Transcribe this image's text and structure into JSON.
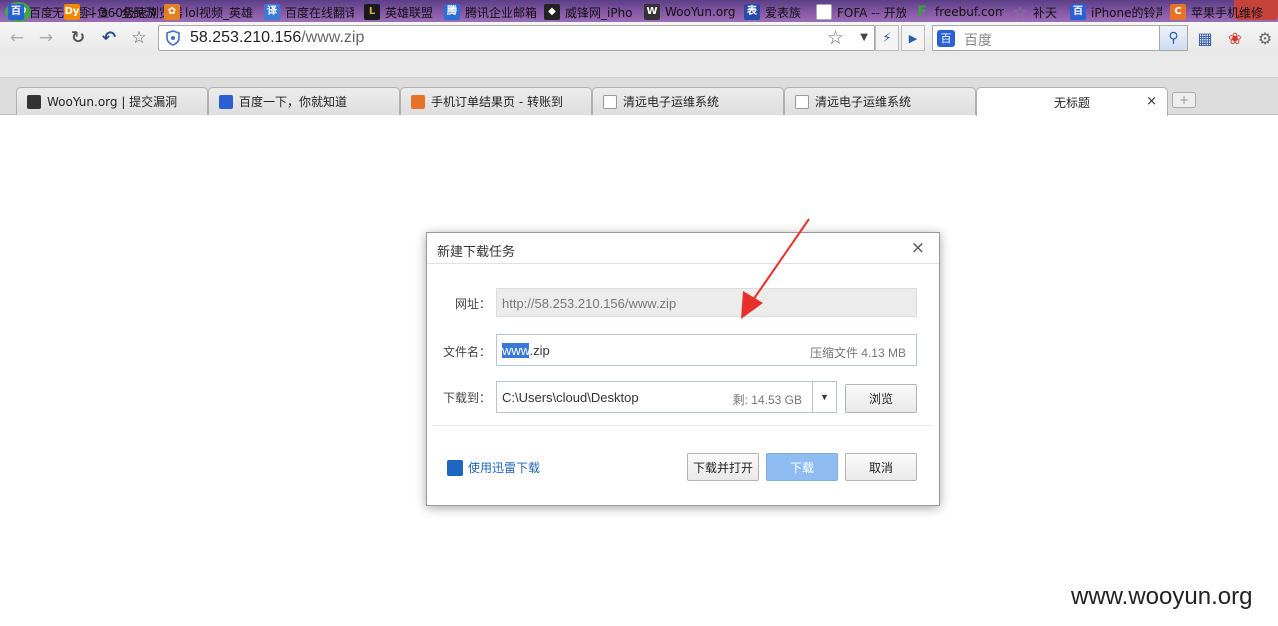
{
  "window": {
    "title": "无标题 - 360极速浏览器"
  },
  "toolbar": {
    "back_icon": "←",
    "forward_icon": "→",
    "reload_icon": "↻",
    "undo_icon": "↶",
    "bookmark_icon": "☆",
    "url_host": "58.253.210.156",
    "url_path": "/www.zip",
    "star_icon": "☆",
    "dropdown_icon": "▼",
    "bolt_icon": "⚡",
    "play_icon": "▶",
    "search_placeholder": "百度",
    "search_engine_icon": "百",
    "search_icon": "⚲"
  },
  "bookmarks": [
    {
      "label": "百度",
      "icon_color": "#2b5fd4",
      "icon_char": "百"
    },
    {
      "label": "斗鱼 - 全民游",
      "icon_color": "#f08a00",
      "icon_char": "Dy"
    },
    {
      "label": "lol视频_英雄",
      "icon_color": "#e67e22",
      "icon_char": "✿"
    },
    {
      "label": "百度在线翻译",
      "icon_color": "#3a7bd5",
      "icon_char": "译"
    },
    {
      "label": "英雄联盟",
      "icon_color": "#1a1a1a",
      "icon_char": "L"
    },
    {
      "label": "腾讯企业邮箱",
      "icon_color": "#2a6fd6",
      "icon_char": "腾"
    },
    {
      "label": "威锋网_iPho",
      "icon_color": "#222222",
      "icon_char": "◆"
    },
    {
      "label": "WooYun.org",
      "icon_color": "#333333",
      "icon_char": "W"
    },
    {
      "label": "爱表族",
      "icon_color": "#2a4aa8",
      "icon_char": "表"
    },
    {
      "label": "FOFA -- 开放",
      "icon_color": "#dddddd",
      "icon_char": ""
    },
    {
      "label": "freebuf.com",
      "icon_color": "#3aa53a",
      "icon_char": "F"
    },
    {
      "label": "补天",
      "icon_color": "#888888",
      "icon_char": "☆"
    },
    {
      "label": "iPhone的铃声",
      "icon_color": "#2b5fd4",
      "icon_char": "百"
    },
    {
      "label": "苹果手机维修",
      "icon_color": "#e8722a",
      "icon_char": "C"
    }
  ],
  "tabs": [
    {
      "label": "WooYun.org | 提交漏洞",
      "icon_color": "#333333"
    },
    {
      "label": "百度一下，你就知道",
      "icon_color": "#2b5fd4"
    },
    {
      "label": "手机订单结果页 - 转账到",
      "icon_color": "#e8722a"
    },
    {
      "label": "清远电子运维系统",
      "icon_color": "#dddddd"
    },
    {
      "label": "清远电子运维系统",
      "icon_color": "#dddddd"
    },
    {
      "label": "无标题",
      "icon_color": ""
    }
  ],
  "tab_close_icon": "×",
  "new_tab_icon": "+",
  "dialog": {
    "title": "新建下载任务",
    "close_icon": "×",
    "url_label": "网址：",
    "url_value": "http://58.253.210.156/www.zip",
    "filename_label": "文件名：",
    "filename_selected": "www",
    "filename_rest": ".zip",
    "file_info": "压缩文件 4.13 MB",
    "saveto_label": "下载到：",
    "saveto_value": "C:\\Users\\cloud\\Desktop",
    "free_space": "剩: 14.53 GB",
    "dropdown_icon": "▼",
    "browse_label": "浏览",
    "xunlei_label": "使用迅雷下载",
    "download_open_label": "下载并打开",
    "download_label": "下载",
    "cancel_label": "取消"
  },
  "annotation": {
    "arrow_color": "#e8302a"
  },
  "watermark": "www.wooyun.org"
}
